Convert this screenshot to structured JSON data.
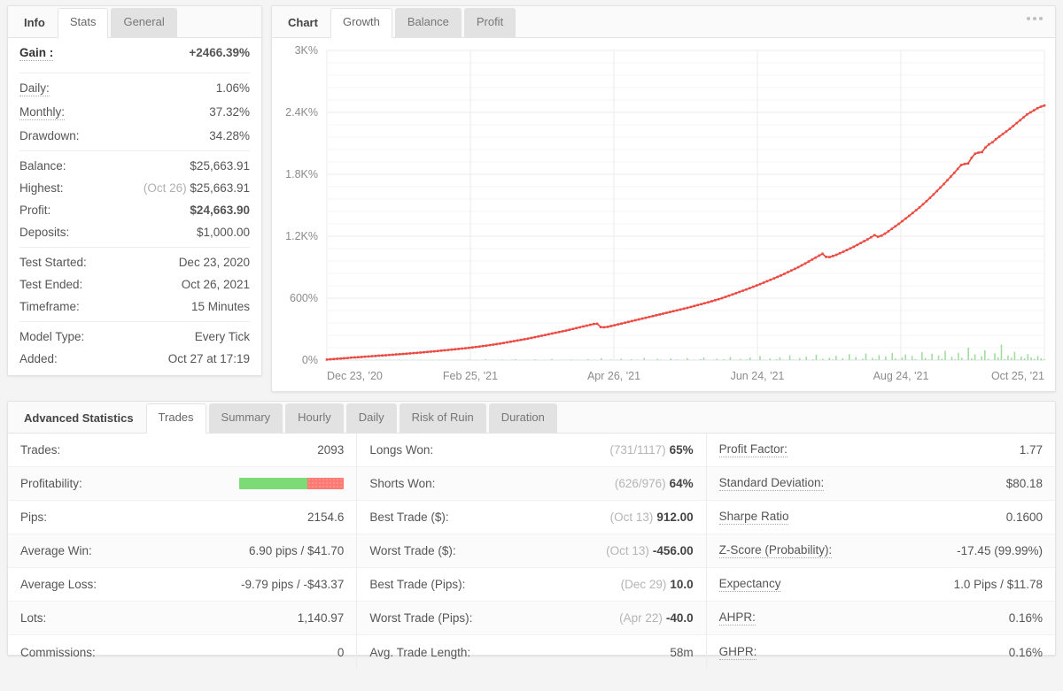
{
  "left_panel": {
    "tab_label": "Info",
    "tabs": [
      {
        "label": "Stats",
        "active": true
      },
      {
        "label": "General",
        "active": false
      }
    ],
    "rows": [
      {
        "label": "Gain :",
        "value": "+2466.39%"
      },
      {
        "label": "Daily:",
        "value": "1.06%"
      },
      {
        "label": "Monthly:",
        "value": "37.32%"
      },
      {
        "label": "Drawdown:",
        "value": "34.28%"
      },
      {
        "label": "Balance:",
        "value": "$25,663.91"
      },
      {
        "label": "Highest:",
        "prefix": "(Oct 26)",
        "value": "$25,663.91"
      },
      {
        "label": "Profit:",
        "value": "$24,663.90"
      },
      {
        "label": "Deposits:",
        "value": "$1,000.00"
      },
      {
        "label": "Test Started:",
        "value": "Dec 23, 2020"
      },
      {
        "label": "Test Ended:",
        "value": "Oct 26, 2021"
      },
      {
        "label": "Timeframe:",
        "value": "15 Minutes"
      },
      {
        "label": "Model Type:",
        "value": "Every Tick"
      },
      {
        "label": "Added:",
        "value": "Oct 27 at 17:19"
      }
    ]
  },
  "chart_panel": {
    "tab_label": "Chart",
    "tabs": [
      {
        "label": "Growth",
        "active": true
      },
      {
        "label": "Balance",
        "active": false
      },
      {
        "label": "Profit",
        "active": false
      }
    ],
    "more_icon": "more-horizontal-icon"
  },
  "chart_data": {
    "type": "line",
    "title": "Growth",
    "xlabel": "",
    "ylabel": "",
    "ylim": [
      0,
      3000
    ],
    "yticks": [
      0,
      600,
      1200,
      1800,
      2400,
      3000
    ],
    "ytick_labels": [
      "0%",
      "600%",
      "1.2K%",
      "1.8K%",
      "2.4K%",
      "3K%"
    ],
    "xtick_labels": [
      "Dec 23, '20",
      "Feb 25, '21",
      "Apr 26, '21",
      "Jun 24, '21",
      "Aug 24, '21",
      "Oct 25, '21"
    ],
    "grid": true,
    "legend": "none",
    "series": [
      {
        "name": "Growth",
        "type": "line",
        "color": "#eb4a42",
        "values": [
          5,
          8,
          10,
          13,
          15,
          18,
          20,
          24,
          26,
          28,
          30,
          33,
          35,
          38,
          40,
          43,
          45,
          47,
          50,
          52,
          55,
          57,
          60,
          62,
          65,
          68,
          70,
          73,
          76,
          79,
          82,
          85,
          88,
          92,
          95,
          98,
          102,
          105,
          108,
          112,
          115,
          119,
          123,
          127,
          131,
          136,
          140,
          145,
          150,
          155,
          160,
          166,
          172,
          178,
          184,
          190,
          196,
          202,
          208,
          215,
          222,
          229,
          236,
          243,
          250,
          258,
          265,
          272,
          279,
          286,
          294,
          302,
          310,
          318,
          326,
          334,
          342,
          350,
          352,
          320,
          318,
          322,
          330,
          338,
          346,
          354,
          362,
          370,
          378,
          386,
          394,
          402,
          410,
          418,
          426,
          434,
          442,
          450,
          458,
          466,
          474,
          482,
          490,
          498,
          506,
          515,
          524,
          533,
          542,
          551,
          560,
          570,
          580,
          590,
          600,
          612,
          624,
          636,
          648,
          660,
          672,
          684,
          697,
          710,
          723,
          736,
          750,
          764,
          778,
          792,
          806,
          820,
          836,
          852,
          868,
          884,
          900,
          918,
          936,
          955,
          974,
          993,
          1012,
          1030,
          1000,
          998,
          1008,
          1020,
          1035,
          1050,
          1066,
          1082,
          1098,
          1116,
          1134,
          1152,
          1170,
          1190,
          1210,
          1195,
          1205,
          1225,
          1248,
          1272,
          1296,
          1320,
          1346,
          1372,
          1398,
          1425,
          1452,
          1480,
          1510,
          1540,
          1572,
          1604,
          1638,
          1672,
          1706,
          1742,
          1778,
          1814,
          1852,
          1890,
          1900,
          1905,
          1960,
          2000,
          2010,
          2015,
          2060,
          2090,
          2110,
          2140,
          2165,
          2190,
          2215,
          2240,
          2268,
          2296,
          2324,
          2352,
          2380,
          2400,
          2420,
          2440,
          2455,
          2466
        ]
      },
      {
        "name": "Volume",
        "type": "bar",
        "color": "#9fdc9c",
        "scale_max": 3000,
        "values": [
          2,
          0,
          3,
          1,
          0,
          4,
          2,
          0,
          1,
          5,
          2,
          0,
          3,
          1,
          0,
          2,
          4,
          1,
          0,
          3,
          2,
          0,
          5,
          1,
          2,
          0,
          3,
          1,
          4,
          0,
          2,
          1,
          3,
          0,
          5,
          2,
          1,
          0,
          3,
          4,
          1,
          0,
          2,
          5,
          1,
          3,
          0,
          2,
          8,
          1,
          4,
          0,
          2,
          6,
          1,
          0,
          3,
          9,
          2,
          1,
          0,
          4,
          2,
          7,
          1,
          0,
          3,
          2,
          12,
          1,
          0,
          4,
          2,
          0,
          6,
          1,
          3,
          0,
          2,
          10,
          1,
          4,
          0,
          18,
          2,
          1,
          6,
          0,
          3,
          14,
          1,
          0,
          8,
          2,
          4,
          0,
          22,
          1,
          3,
          0,
          12,
          5,
          1,
          0,
          16,
          2,
          7,
          0,
          4,
          20,
          1,
          3,
          0,
          9,
          26,
          2,
          0,
          5,
          14,
          1,
          8,
          0,
          30,
          3,
          1,
          12,
          0,
          6,
          24,
          2,
          0,
          38,
          4,
          1,
          16,
          0,
          9,
          28,
          3,
          0,
          46,
          5,
          2,
          20,
          1,
          34,
          0,
          8,
          52,
          3,
          14,
          0,
          24,
          6,
          42,
          1,
          18,
          0,
          58,
          4,
          30,
          2,
          12,
          64,
          0,
          22,
          8,
          48,
          1,
          36,
          0,
          70,
          16,
          5,
          26,
          54,
          2,
          40,
          10,
          0,
          78,
          20,
          6,
          62,
          1,
          44,
          14,
          90,
          0,
          32,
          8,
          70,
          24,
          2,
          120,
          18,
          56,
          4,
          38,
          96,
          12,
          0,
          66,
          28,
          150,
          10,
          44,
          22,
          80,
          6,
          34,
          16,
          58,
          26,
          12,
          40,
          18,
          8
        ]
      }
    ]
  },
  "bottom_panel": {
    "tab_label": "Advanced Statistics",
    "tabs": [
      {
        "label": "Trades",
        "active": true
      },
      {
        "label": "Summary",
        "active": false
      },
      {
        "label": "Hourly",
        "active": false
      },
      {
        "label": "Daily",
        "active": false
      },
      {
        "label": "Risk of Ruin",
        "active": false
      },
      {
        "label": "Duration",
        "active": false
      }
    ],
    "columns": [
      {
        "rows": [
          {
            "label": "Trades:",
            "value": "2093"
          },
          {
            "label": "Profitability:",
            "value": "",
            "bar": {
              "green_pct": 65,
              "red_pct": 35
            }
          },
          {
            "label": "Pips:",
            "value": "2154.6"
          },
          {
            "label": "Average Win:",
            "value": "6.90 pips / $41.70"
          },
          {
            "label": "Average Loss:",
            "value": "-9.79 pips / -$43.37"
          },
          {
            "label": "Lots:",
            "value": "1,140.97"
          },
          {
            "label": "Commissions:",
            "value": "0"
          }
        ]
      },
      {
        "rows": [
          {
            "label": "Longs Won:",
            "prefix": "(731/1117)",
            "value": "65%",
            "bold": true
          },
          {
            "label": "Shorts Won:",
            "prefix": "(626/976)",
            "value": "64%",
            "bold": true
          },
          {
            "label": "Best Trade ($):",
            "prefix": "(Oct 13)",
            "value": "912.00",
            "bold": true
          },
          {
            "label": "Worst Trade ($):",
            "prefix": "(Oct 13)",
            "value": "-456.00",
            "bold": true
          },
          {
            "label": "Best Trade (Pips):",
            "prefix": "(Dec 29)",
            "value": "10.0",
            "bold": true
          },
          {
            "label": "Worst Trade (Pips):",
            "prefix": "(Apr 22)",
            "value": "-40.0",
            "bold": true
          },
          {
            "label": "Avg. Trade Length:",
            "value": "58m"
          }
        ]
      },
      {
        "rows": [
          {
            "label": "Profit Factor:",
            "value": "1.77",
            "dotted": true
          },
          {
            "label": "Standard Deviation:",
            "value": "$80.18",
            "dotted": true
          },
          {
            "label": "Sharpe Ratio",
            "value": "0.1600",
            "dotted": true
          },
          {
            "label": "Z-Score (Probability):",
            "value": "-17.45 (99.99%)",
            "dotted": true
          },
          {
            "label": "Expectancy",
            "value": "1.0 Pips / $11.78",
            "dotted": true
          },
          {
            "label": "AHPR:",
            "value": "0.16%",
            "dotted": true
          },
          {
            "label": "GHPR:",
            "value": "0.16%",
            "dotted": true
          }
        ]
      }
    ]
  },
  "colors": {
    "growth_line": "#eb4a42",
    "volume_bar": "#9fdc9c",
    "positive": "#23c03c",
    "bar_green": "#7ddb77",
    "bar_red": "#fb7b74"
  }
}
